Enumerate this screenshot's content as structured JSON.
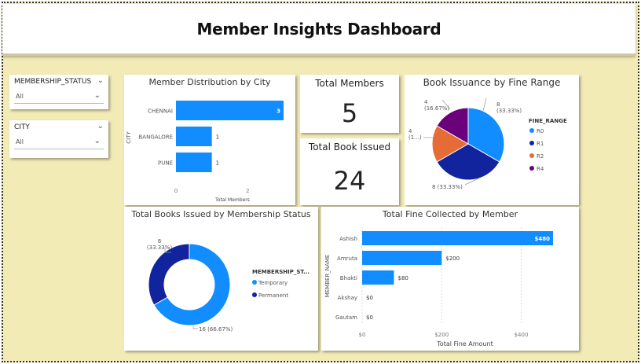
{
  "dashboard": {
    "title": "Member Insights Dashboard"
  },
  "slicers": [
    {
      "label": "MEMBERSHIP_STATUS",
      "value": "All"
    },
    {
      "label": "CITY",
      "value": "All"
    }
  ],
  "kpis": {
    "total_members": {
      "label": "Total Members",
      "value": "5"
    },
    "total_book_issued": {
      "label": "Total Book Issued",
      "value": "24"
    }
  },
  "colors": {
    "blue": "#118dff",
    "navy": "#12239e",
    "orange": "#e66c37",
    "purple": "#6b007b"
  },
  "chart_data": [
    {
      "id": "city",
      "type": "bar",
      "title": "Member Distribution by City",
      "xlabel": "Total Members",
      "ylabel": "CITY",
      "categories": [
        "CHENNAI",
        "BANGALORE",
        "PUNE"
      ],
      "values": [
        3,
        1,
        1
      ],
      "data_labels": [
        "3",
        "1",
        "1"
      ],
      "xlim": [
        0,
        3
      ],
      "xticks": [
        "0",
        "2"
      ],
      "orientation": "horizontal"
    },
    {
      "id": "fine_range",
      "type": "pie",
      "title": "Book Issuance by Fine Range",
      "legend_title": "FINE_RANGE",
      "labels": [
        "R0",
        "R1",
        "R2",
        "R4"
      ],
      "values": [
        8,
        8,
        4,
        4
      ],
      "data_labels": [
        "8\n(33.33%)",
        "8 (33.33%)",
        "4\n(1...)",
        "4\n(16.67%)"
      ],
      "legend": "right"
    },
    {
      "id": "membership",
      "type": "pie",
      "subtype": "donut",
      "title": "Total Books Issued by Membership Status",
      "legend_title": "MEMBERSHIP_ST...",
      "labels": [
        "Temporary",
        "Permanent"
      ],
      "values": [
        16,
        8
      ],
      "data_labels": [
        "16 (66.67%)",
        "8\n(33.33%)"
      ],
      "legend": "right"
    },
    {
      "id": "fine_member",
      "type": "bar",
      "title": "Total Fine Collected by Member",
      "xlabel": "Total Fine Amount",
      "ylabel": "MEMBER_NAME",
      "categories": [
        "Ashish",
        "Amruta",
        "Bhakti",
        "Akshay",
        "Gautam"
      ],
      "values": [
        480,
        200,
        80,
        0,
        0
      ],
      "data_labels": [
        "$480",
        "$200",
        "$80",
        "$0",
        "$0"
      ],
      "xlim": [
        0,
        480
      ],
      "xticks": [
        "$0",
        "$200",
        "$400"
      ],
      "orientation": "horizontal"
    }
  ]
}
